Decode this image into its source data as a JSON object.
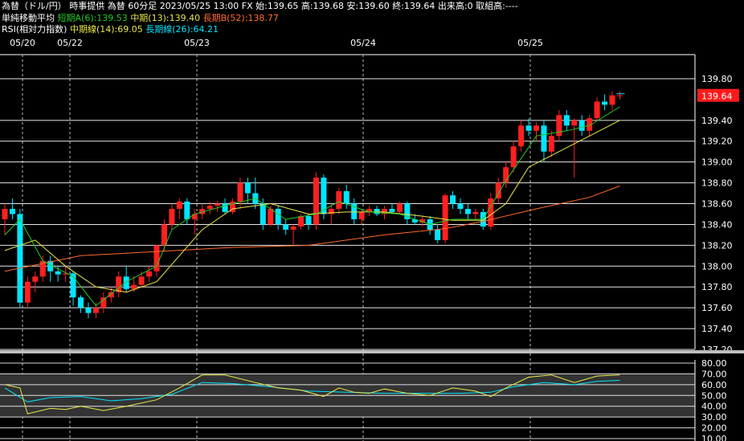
{
  "header": {
    "line1": "為替（ドル/円） 時事提供 為替 60分足 2023/05/25 13:00 FX 始:139.65 高:139.68 安:139.60 終:139.64 出来高:0 取組高:----",
    "ma_title": "単純移動平均",
    "ma_short": "短期A(6):139.53",
    "ma_mid": "中期(13):139.40",
    "ma_long": "長期B(52):138.77",
    "rsi_title": "RSI(相対力指数)",
    "rsi_mid": "中期線(14):69.05",
    "rsi_long": "長期線(26):64.21"
  },
  "colors": {
    "background": "#000000",
    "up": "#ff2020",
    "down": "#00e5ff",
    "ma_short": "#22cc22",
    "ma_mid": "#e8e84a",
    "ma_long": "#ff6a2a",
    "rsi_mid": "#e8e84a",
    "rsi_long": "#00e5ff",
    "current_price_bg": "#ff1a1a",
    "ma_short_text": "#22cc22",
    "ma_mid_text": "#e8e84a",
    "ma_long_text": "#ff6a2a",
    "rsi_long_text": "#00e5ff"
  },
  "chart_data": [
    {
      "type": "candlestick",
      "ylim": [
        137.2,
        139.9
      ],
      "yticks": [
        "139.80",
        "139.40",
        "139.20",
        "139.00",
        "138.80",
        "138.60",
        "138.40",
        "138.20",
        "138.00",
        "137.80",
        "137.60",
        "137.40",
        "137.20"
      ],
      "date_labels": [
        "05/20",
        "05/22",
        "05/23",
        "05/24",
        "05/25"
      ],
      "current_price": "139.64",
      "candles": [
        [
          138.45,
          138.6,
          138.3,
          138.55
        ],
        [
          138.55,
          138.65,
          138.45,
          138.5
        ],
        [
          138.5,
          138.55,
          137.6,
          137.65
        ],
        [
          137.65,
          137.9,
          137.6,
          137.85
        ],
        [
          137.85,
          137.95,
          137.75,
          137.9
        ],
        [
          137.9,
          138.1,
          137.85,
          138.05
        ],
        [
          138.05,
          138.1,
          137.85,
          137.95
        ],
        [
          137.95,
          138.0,
          137.85,
          137.92
        ],
        [
          137.92,
          138.0,
          137.85,
          137.93
        ],
        [
          137.93,
          137.95,
          137.62,
          137.7
        ],
        [
          137.7,
          137.72,
          137.55,
          137.6
        ],
        [
          137.6,
          137.65,
          137.5,
          137.55
        ],
        [
          137.55,
          137.65,
          137.5,
          137.6
        ],
        [
          137.6,
          137.75,
          137.55,
          137.7
        ],
        [
          137.7,
          137.8,
          137.65,
          137.75
        ],
        [
          137.75,
          137.95,
          137.7,
          137.9
        ],
        [
          137.9,
          138.0,
          137.75,
          137.78
        ],
        [
          137.78,
          137.9,
          137.75,
          137.82
        ],
        [
          137.82,
          137.95,
          137.8,
          137.9
        ],
        [
          137.9,
          138.0,
          137.85,
          137.95
        ],
        [
          137.95,
          138.2,
          137.9,
          138.2
        ],
        [
          138.2,
          138.45,
          138.15,
          138.4
        ],
        [
          138.4,
          138.6,
          138.35,
          138.55
        ],
        [
          138.55,
          138.65,
          138.45,
          138.62
        ],
        [
          138.62,
          138.65,
          138.4,
          138.45
        ],
        [
          138.45,
          138.55,
          138.3,
          138.5
        ],
        [
          138.5,
          138.6,
          138.45,
          138.55
        ],
        [
          138.55,
          138.62,
          138.5,
          138.58
        ],
        [
          138.58,
          138.63,
          138.52,
          138.6
        ],
        [
          138.6,
          138.65,
          138.5,
          138.52
        ],
        [
          138.52,
          138.65,
          138.5,
          138.62
        ],
        [
          138.62,
          138.85,
          138.55,
          138.8
        ],
        [
          138.8,
          138.85,
          138.6,
          138.7
        ],
        [
          138.7,
          138.85,
          138.55,
          138.6
        ],
        [
          138.6,
          138.65,
          138.35,
          138.4
        ],
        [
          138.4,
          138.58,
          138.38,
          138.55
        ],
        [
          138.55,
          138.58,
          138.35,
          138.4
        ],
        [
          138.4,
          138.45,
          138.3,
          138.35
        ],
        [
          138.35,
          138.4,
          138.2,
          138.38
        ],
        [
          138.38,
          138.5,
          138.35,
          138.48
        ],
        [
          138.48,
          138.5,
          138.35,
          138.4
        ],
        [
          138.4,
          138.9,
          138.35,
          138.85
        ],
        [
          138.85,
          138.88,
          138.45,
          138.5
        ],
        [
          138.5,
          138.6,
          138.4,
          138.55
        ],
        [
          138.55,
          138.75,
          138.5,
          138.72
        ],
        [
          138.72,
          138.78,
          138.55,
          138.6
        ],
        [
          138.6,
          138.65,
          138.4,
          138.45
        ],
        [
          138.45,
          138.55,
          138.4,
          138.52
        ],
        [
          138.52,
          138.58,
          138.48,
          138.55
        ],
        [
          138.55,
          138.58,
          138.48,
          138.5
        ],
        [
          138.5,
          138.58,
          138.45,
          138.55
        ],
        [
          138.55,
          138.6,
          138.5,
          138.52
        ],
        [
          138.52,
          138.62,
          138.5,
          138.6
        ],
        [
          138.6,
          138.62,
          138.4,
          138.45
        ],
        [
          138.45,
          138.5,
          138.4,
          138.42
        ],
        [
          138.42,
          138.48,
          138.38,
          138.45
        ],
        [
          138.45,
          138.48,
          138.3,
          138.35
        ],
        [
          138.35,
          138.4,
          138.22,
          138.25
        ],
        [
          138.25,
          138.7,
          138.22,
          138.68
        ],
        [
          138.68,
          138.72,
          138.55,
          138.6
        ],
        [
          138.6,
          138.65,
          138.5,
          138.55
        ],
        [
          138.55,
          138.6,
          138.45,
          138.5
        ],
        [
          138.5,
          138.55,
          138.45,
          138.52
        ],
        [
          138.52,
          138.55,
          138.35,
          138.38
        ],
        [
          138.38,
          138.7,
          138.35,
          138.65
        ],
        [
          138.65,
          138.85,
          138.6,
          138.8
        ],
        [
          138.8,
          139.0,
          138.75,
          138.95
        ],
        [
          138.95,
          139.2,
          138.9,
          139.15
        ],
        [
          139.15,
          139.4,
          139.1,
          139.35
        ],
        [
          139.35,
          139.42,
          139.25,
          139.3
        ],
        [
          139.3,
          139.38,
          139.2,
          139.35
        ],
        [
          139.35,
          139.4,
          139.0,
          139.1
        ],
        [
          139.1,
          139.3,
          139.05,
          139.25
        ],
        [
          139.25,
          139.5,
          139.2,
          139.45
        ],
        [
          139.45,
          139.5,
          139.3,
          139.35
        ],
        [
          139.35,
          139.42,
          138.85,
          139.4
        ],
        [
          139.4,
          139.45,
          139.25,
          139.3
        ],
        [
          139.3,
          139.45,
          139.25,
          139.42
        ],
        [
          139.42,
          139.62,
          139.4,
          139.58
        ],
        [
          139.58,
          139.65,
          139.5,
          139.55
        ],
        [
          139.55,
          139.68,
          139.5,
          139.64
        ],
        [
          139.64,
          139.68,
          139.6,
          139.64
        ]
      ],
      "ma_short": [
        [
          0,
          138.3
        ],
        [
          2,
          138.45
        ],
        [
          5,
          138.05
        ],
        [
          9,
          137.9
        ],
        [
          12,
          137.62
        ],
        [
          16,
          137.85
        ],
        [
          20,
          138.0
        ],
        [
          22,
          138.35
        ],
        [
          25,
          138.5
        ],
        [
          29,
          138.58
        ],
        [
          33,
          138.65
        ],
        [
          37,
          138.45
        ],
        [
          41,
          138.5
        ],
        [
          44,
          138.62
        ],
        [
          48,
          138.52
        ],
        [
          52,
          138.5
        ],
        [
          56,
          138.4
        ],
        [
          59,
          138.45
        ],
        [
          63,
          138.45
        ],
        [
          66,
          138.82
        ],
        [
          70,
          139.25
        ],
        [
          74,
          139.3
        ],
        [
          77,
          139.35
        ],
        [
          81,
          139.53
        ]
      ],
      "ma_mid": [
        [
          0,
          138.15
        ],
        [
          4,
          138.25
        ],
        [
          8,
          138.0
        ],
        [
          12,
          137.8
        ],
        [
          16,
          137.75
        ],
        [
          20,
          137.85
        ],
        [
          23,
          138.1
        ],
        [
          26,
          138.35
        ],
        [
          30,
          138.55
        ],
        [
          35,
          138.6
        ],
        [
          40,
          138.5
        ],
        [
          45,
          138.52
        ],
        [
          50,
          138.52
        ],
        [
          55,
          138.48
        ],
        [
          59,
          138.44
        ],
        [
          63,
          138.44
        ],
        [
          66,
          138.6
        ],
        [
          69,
          138.95
        ],
        [
          73,
          139.1
        ],
        [
          77,
          139.25
        ],
        [
          81,
          139.4
        ]
      ],
      "ma_long": [
        [
          0,
          137.95
        ],
        [
          10,
          138.1
        ],
        [
          20,
          138.14
        ],
        [
          30,
          138.18
        ],
        [
          40,
          138.2
        ],
        [
          50,
          138.3
        ],
        [
          58,
          138.36
        ],
        [
          63,
          138.43
        ],
        [
          70,
          138.55
        ],
        [
          77,
          138.66
        ],
        [
          81,
          138.77
        ]
      ]
    },
    {
      "type": "line",
      "ylim": [
        10,
        80
      ],
      "yticks": [
        "80.00",
        "70.00",
        "60.00",
        "50.00",
        "40.00",
        "30.00",
        "20.00",
        "10.00"
      ],
      "rsi_mid": [
        [
          0,
          60
        ],
        [
          2,
          57
        ],
        [
          3,
          33
        ],
        [
          6,
          38
        ],
        [
          8,
          37
        ],
        [
          10,
          40
        ],
        [
          13,
          36
        ],
        [
          16,
          40
        ],
        [
          20,
          46
        ],
        [
          23,
          57
        ],
        [
          26,
          69
        ],
        [
          29,
          69
        ],
        [
          33,
          62
        ],
        [
          36,
          57
        ],
        [
          39,
          55
        ],
        [
          42,
          49
        ],
        [
          44,
          57
        ],
        [
          46,
          53
        ],
        [
          48,
          52
        ],
        [
          50,
          56
        ],
        [
          53,
          52
        ],
        [
          56,
          50
        ],
        [
          59,
          57
        ],
        [
          62,
          54
        ],
        [
          64,
          49
        ],
        [
          66,
          57
        ],
        [
          69,
          67
        ],
        [
          72,
          69
        ],
        [
          75,
          62
        ],
        [
          78,
          68
        ],
        [
          81,
          69
        ]
      ],
      "rsi_long": [
        [
          0,
          57
        ],
        [
          3,
          44
        ],
        [
          6,
          48
        ],
        [
          10,
          49
        ],
        [
          14,
          45
        ],
        [
          18,
          47
        ],
        [
          22,
          51
        ],
        [
          26,
          62
        ],
        [
          30,
          61
        ],
        [
          35,
          58
        ],
        [
          40,
          54
        ],
        [
          45,
          53
        ],
        [
          50,
          52
        ],
        [
          55,
          52
        ],
        [
          60,
          52
        ],
        [
          64,
          53
        ],
        [
          67,
          58
        ],
        [
          71,
          62
        ],
        [
          75,
          60
        ],
        [
          78,
          63
        ],
        [
          81,
          64
        ]
      ]
    }
  ]
}
